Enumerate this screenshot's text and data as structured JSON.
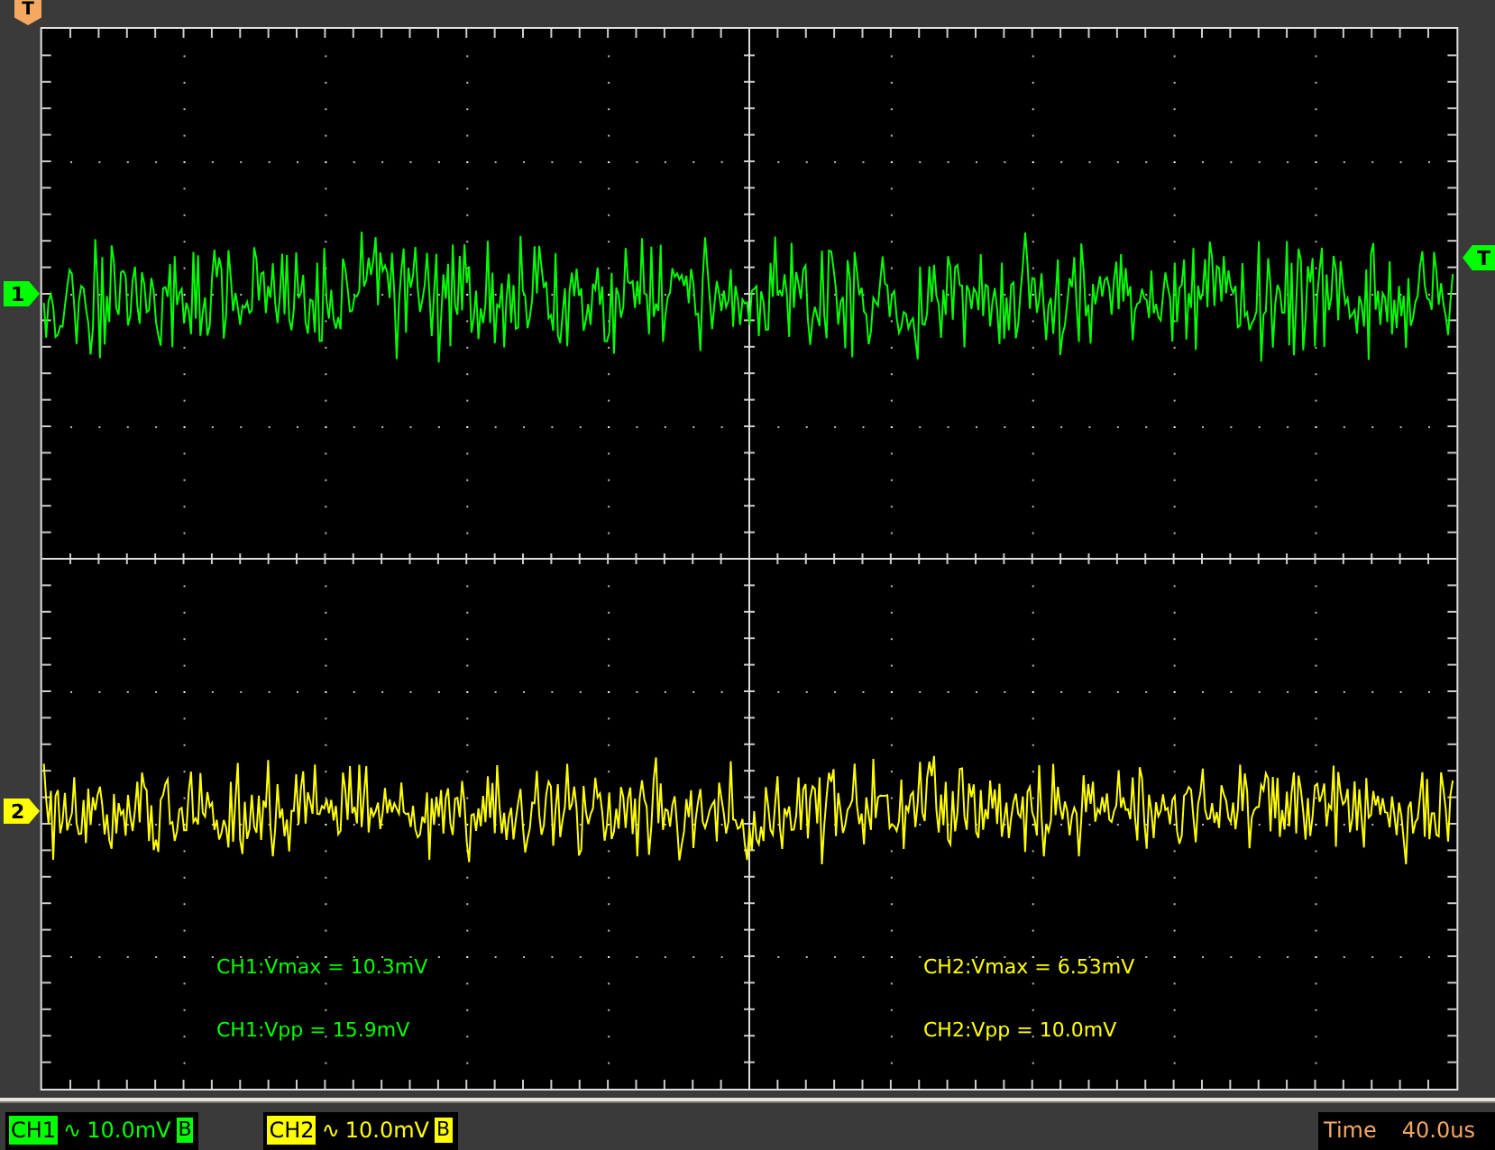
{
  "trigger_position_marker": {
    "label": "T"
  },
  "trigger_level_marker": {
    "label": "T"
  },
  "channels": [
    {
      "marker": "1",
      "color": "#00ff00",
      "measurements": [
        "CH1:Vmax = 10.3mV",
        "CH1:Vpp = 15.9mV"
      ],
      "status": {
        "label": "CH1",
        "coupling": "∿",
        "scale": "10.0mV",
        "bandwidth": "B"
      }
    },
    {
      "marker": "2",
      "color": "#ffff00",
      "measurements": [
        "CH2:Vmax = 6.53mV",
        "CH2:Vpp = 10.0mV"
      ],
      "status": {
        "label": "CH2",
        "coupling": "∿",
        "scale": "10.0mV",
        "bandwidth": "B"
      }
    }
  ],
  "timebase": {
    "label": "Time",
    "value": "40.0us"
  }
}
